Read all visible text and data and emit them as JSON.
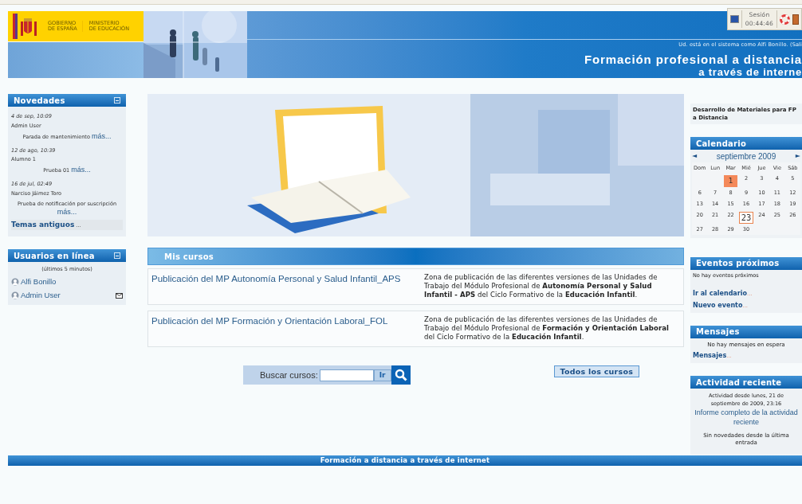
{
  "header": {
    "logo_lines": [
      "GOBIERNO",
      "DE ESPAÑA"
    ],
    "ministry_lines": [
      "MINISTERIO",
      "DE EDUCACIÓN"
    ],
    "session": {
      "label": "Sesión",
      "time": "00:44:46"
    },
    "login_info": "Ud. está en el sistema como Alfi Bonillo. (Sali",
    "title": "Formación profesional a distancia",
    "subtitle": "a través de interne"
  },
  "left": {
    "news": {
      "title": "Novedades",
      "items": [
        {
          "date": "4 de sep, 10:09",
          "author": "Admin User",
          "subject": "Parada de mantenimiento",
          "more": "más..."
        },
        {
          "date": "12 de ago, 10:39",
          "author": "Alumno 1",
          "subject": "Prueba 01",
          "more": "más..."
        },
        {
          "date": "16 de jul, 02:49",
          "author": "Narciso Jáimez Toro",
          "subject": "Prueba de notificación por suscripción",
          "more": "más..."
        }
      ],
      "older": "Temas antiguos",
      "older_suffix": "..."
    },
    "online": {
      "title": "Usuarios en línea",
      "note": "(últimos 5 minutos)",
      "users": [
        {
          "name": "Alfi Bonillo",
          "message_icon": false
        },
        {
          "name": "Admin User",
          "message_icon": true
        }
      ]
    }
  },
  "center": {
    "courses_title": "Mis cursos",
    "courses": [
      {
        "name": "Publicación del MP Autonomía Personal y Salud Infantil_APS",
        "summary": "Zona de publicación de las diferentes versiones de las Unidades de Trabajo del Módulo Profesional de **Autonomía Personal y Salud Infantil - APS** del Ciclo Formativo de la **Educación Infantil**."
      },
      {
        "name": "Publicación del MP Formación y Orientación Laboral_FOL",
        "summary": "Zona de publicación de las diferentes versiones de las Unidades de Trabajo del Módulo Profesional de **Formación y Orientación Laboral** del Ciclo Formativo de la **Educación Infantil**."
      }
    ],
    "search": {
      "label": "Buscar cursos:",
      "go": "Ir"
    },
    "all_courses": "Todos los cursos"
  },
  "right": {
    "site_summary": "Desarrollo de Materiales para FP a Distancia",
    "calendar": {
      "title": "Calendario",
      "prev": "◄",
      "month": "septiembre 2009",
      "next": "►",
      "weekdays": [
        "Dom",
        "Lun",
        "Mar",
        "Mié",
        "Jue",
        "Vie",
        "Sáb"
      ],
      "weeks": [
        [
          {
            "kind": "blank"
          },
          {
            "kind": "blank"
          },
          {
            "day": "1",
            "event": true,
            "today": false
          },
          {
            "day": "2",
            "event": false,
            "today": false
          },
          {
            "day": "3",
            "event": false,
            "today": false
          },
          {
            "day": "4",
            "event": false,
            "today": false
          },
          {
            "day": "5",
            "event": false,
            "today": false
          }
        ],
        [
          {
            "day": "6",
            "event": false,
            "today": false
          },
          {
            "day": "7",
            "event": false,
            "today": false
          },
          {
            "day": "8",
            "event": false,
            "today": false
          },
          {
            "day": "9",
            "event": false,
            "today": false
          },
          {
            "day": "10",
            "event": false,
            "today": false
          },
          {
            "day": "11",
            "event": false,
            "today": false
          },
          {
            "day": "12",
            "event": false,
            "today": false
          }
        ],
        [
          {
            "day": "13",
            "event": false,
            "today": false
          },
          {
            "day": "14",
            "event": false,
            "today": false
          },
          {
            "day": "15",
            "event": false,
            "today": false
          },
          {
            "day": "16",
            "event": false,
            "today": false
          },
          {
            "day": "17",
            "event": false,
            "today": false
          },
          {
            "day": "18",
            "event": false,
            "today": false
          },
          {
            "day": "19",
            "event": false,
            "today": false
          }
        ],
        [
          {
            "day": "20",
            "event": false,
            "today": false
          },
          {
            "day": "21",
            "event": false,
            "today": false
          },
          {
            "day": "22",
            "event": false,
            "today": false
          },
          {
            "day": "23",
            "event": false,
            "today": true
          },
          {
            "day": "24",
            "event": false,
            "today": false
          },
          {
            "day": "25",
            "event": false,
            "today": false
          },
          {
            "day": "26",
            "event": false,
            "today": false
          }
        ],
        [
          {
            "day": "27",
            "event": false,
            "today": false
          },
          {
            "day": "28",
            "event": false,
            "today": false
          },
          {
            "day": "29",
            "event": false,
            "today": false
          },
          {
            "day": "30",
            "event": false,
            "today": false
          }
        ]
      ]
    },
    "events": {
      "title": "Eventos próximos",
      "note": "No hay eventos próximos",
      "links": [
        "Ir al calendario",
        "Nuevo evento"
      ],
      "suffix": "..."
    },
    "messages": {
      "title": "Mensajes",
      "note": "No hay mensajes en espera",
      "link": "Mensajes",
      "suffix": "..."
    },
    "activity": {
      "title": "Actividad reciente",
      "since": "Actividad desde lunes, 21 de septiembre de 2009, 23:16",
      "report": "Informe completo de la actividad reciente",
      "note": "Sin novedades desde la última entrada"
    }
  },
  "footer": "Formación a distancia a través de internet"
}
